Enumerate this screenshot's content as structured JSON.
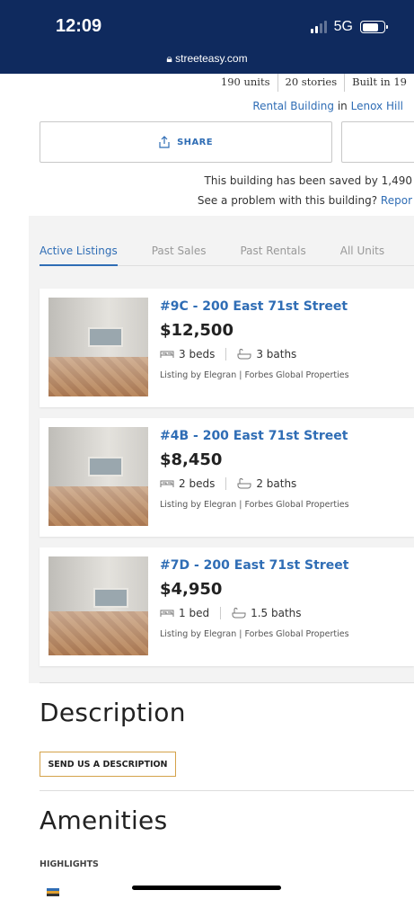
{
  "status": {
    "time": "12:09",
    "network": "5G",
    "url": "streeteasy.com",
    "battery_level": 0.75
  },
  "building": {
    "facts": [
      "190 units",
      "20 stories",
      "Built in 19"
    ],
    "type_prefix": "Rental Building",
    "type_in": "in",
    "neighborhood": "Lenox Hill",
    "saved_text": "This building has been saved by 1,490",
    "problem_prefix": "See a problem with this building?",
    "problem_link": "Repor"
  },
  "actions": {
    "share_label": "SHARE"
  },
  "tabs": [
    "Active Listings",
    "Past Sales",
    "Past Rentals",
    "All Units"
  ],
  "listings": [
    {
      "address": "#9C - 200 East 71st Street",
      "price": "$12,500",
      "beds": "3 beds",
      "baths": "3 baths",
      "broker": "Listing by Elegran | Forbes Global Properties"
    },
    {
      "address": "#4B - 200 East 71st Street",
      "price": "$8,450",
      "beds": "2 beds",
      "baths": "2 baths",
      "broker": "Listing by Elegran | Forbes Global Properties"
    },
    {
      "address": "#7D - 200 East 71st Street",
      "price": "$4,950",
      "beds": "1 bed",
      "baths": "1.5 baths",
      "broker": "Listing by Elegran | Forbes Global Properties"
    }
  ],
  "description": {
    "heading": "Description",
    "button": "SEND US A DESCRIPTION"
  },
  "amenities": {
    "heading": "Amenities",
    "highlights_label": "HIGHLIGHTS"
  },
  "colors": {
    "header_bg": "#0f2a5e",
    "link": "#2f6db5",
    "cta_border": "#d4a24a"
  }
}
